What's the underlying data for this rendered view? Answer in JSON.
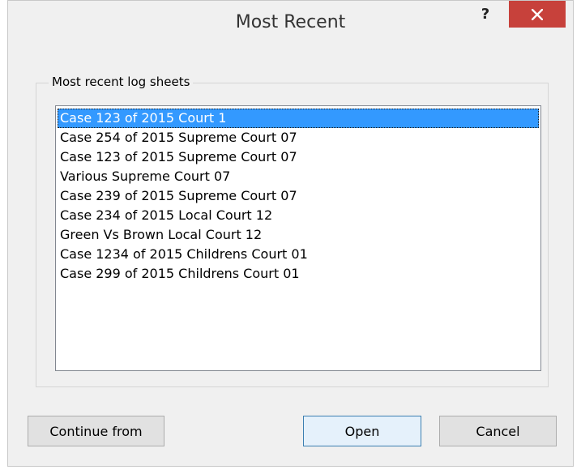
{
  "window": {
    "title": "Most Recent",
    "help_label": "?",
    "close_icon": "close-icon"
  },
  "group": {
    "label": "Most recent log sheets"
  },
  "list": {
    "selected_index": 0,
    "items": [
      "Case 123 of 2015 Court 1",
      "Case 254 of 2015 Supreme Court 07",
      "Case 123 of 2015 Supreme Court 07",
      "Various Supreme Court 07",
      "Case 239 of 2015 Supreme Court 07",
      "Case 234 of 2015 Local Court 12",
      "Green Vs Brown Local Court 12",
      "Case 1234 of 2015 Childrens Court 01",
      "Case 299 of 2015 Childrens Court 01"
    ]
  },
  "buttons": {
    "continue_label": "Continue from",
    "open_label": "Open",
    "cancel_label": "Cancel"
  },
  "colors": {
    "close_bg": "#c7413b",
    "selection": "#3399ff",
    "dialog_bg": "#f0f0f0"
  }
}
